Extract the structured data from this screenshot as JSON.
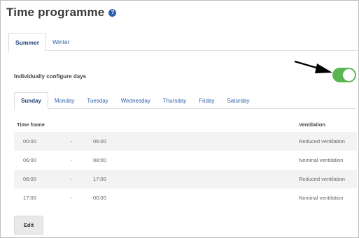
{
  "header": {
    "title": "Time programme",
    "help_icon": "question-circle-icon",
    "help_glyph": "?"
  },
  "season_tabs": [
    {
      "label": "Summer",
      "active": true
    },
    {
      "label": "Winter",
      "active": false
    }
  ],
  "individual_days": {
    "label": "Individually configure days",
    "enabled": true
  },
  "day_tabs": [
    {
      "label": "Sunday",
      "active": true
    },
    {
      "label": "Monday",
      "active": false
    },
    {
      "label": "Tuesday",
      "active": false
    },
    {
      "label": "Wednesday",
      "active": false
    },
    {
      "label": "Thursday",
      "active": false
    },
    {
      "label": "Friday",
      "active": false
    },
    {
      "label": "Saturday",
      "active": false
    }
  ],
  "table": {
    "col_time": "Time frame",
    "col_vent": "Ventilation",
    "rows": [
      {
        "start": "00:00",
        "sep": "-",
        "end": "06:00",
        "vent": "Reduced ventilation"
      },
      {
        "start": "06:00",
        "sep": "-",
        "end": "08:00",
        "vent": "Nominal ventilation"
      },
      {
        "start": "08:00",
        "sep": "-",
        "end": "17:00",
        "vent": "Reduced ventilation"
      },
      {
        "start": "17:00",
        "sep": "-",
        "end": "00:00",
        "vent": "Nominal ventilation"
      }
    ]
  },
  "actions": {
    "edit_label": "Edit"
  },
  "colors": {
    "accent": "#2b5fab",
    "toggle_on": "#5ab553",
    "row_alt": "#f3f3f3"
  }
}
